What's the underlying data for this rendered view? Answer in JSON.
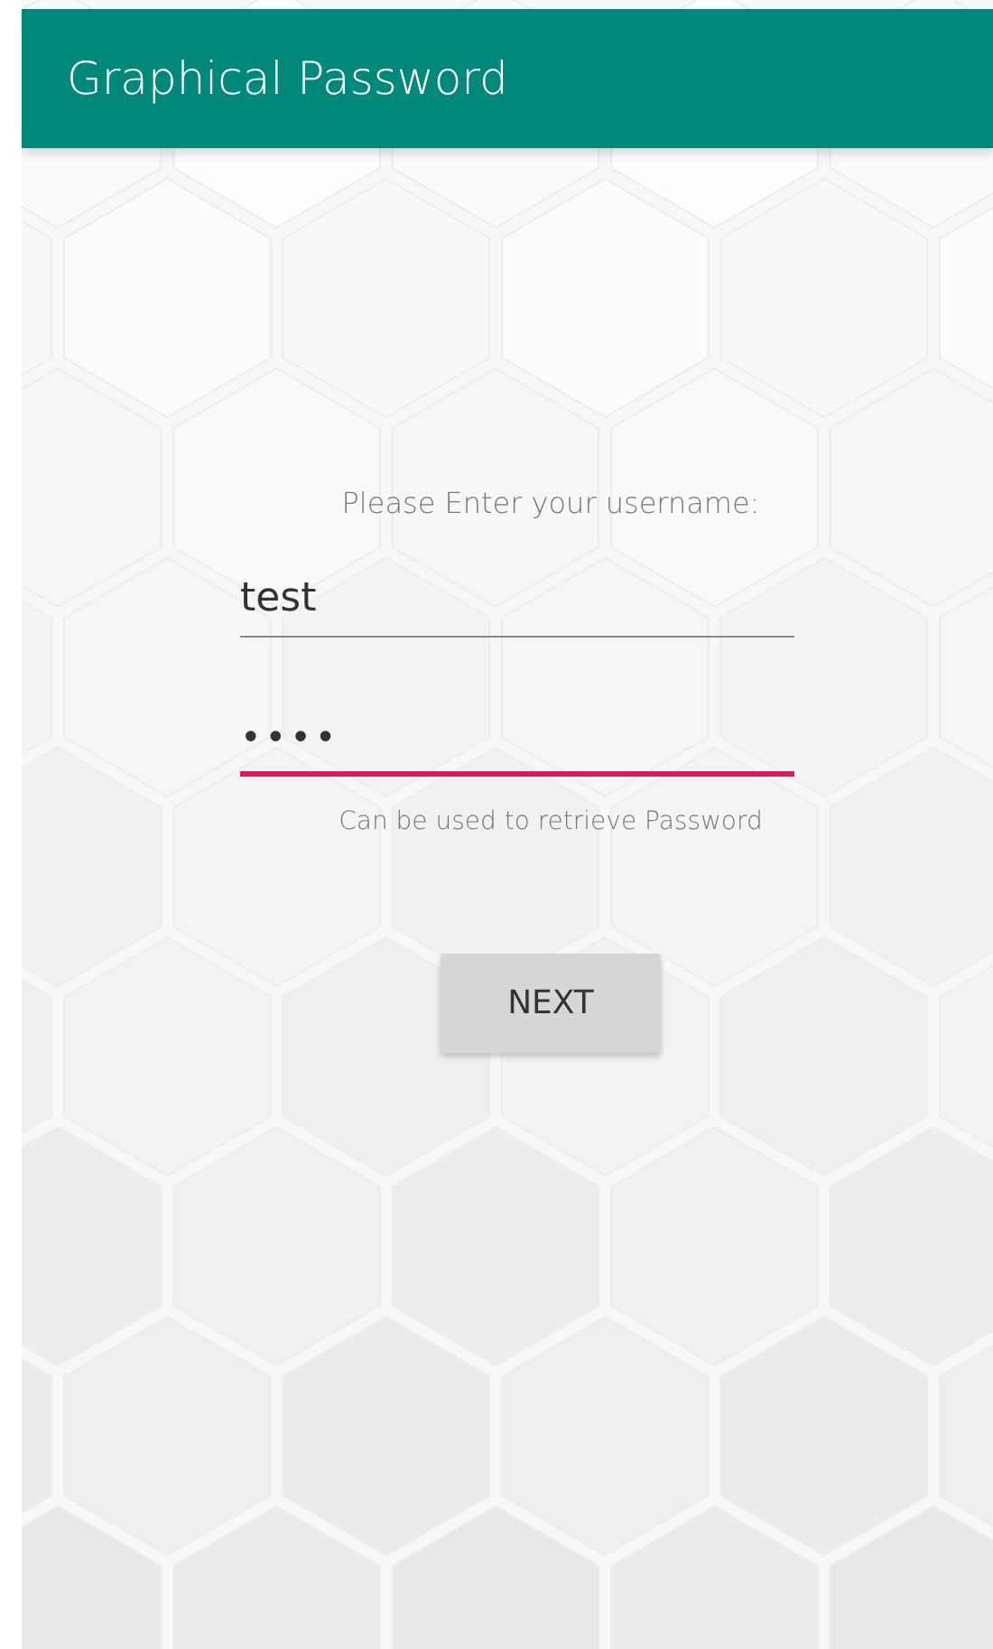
{
  "app_bar": {
    "title": "Graphical Password"
  },
  "form": {
    "prompt": "Please Enter your username:",
    "fields": [
      {
        "kind": "text",
        "value": "test",
        "focused": false
      },
      {
        "kind": "password",
        "value": "••••",
        "focused": true
      }
    ],
    "helper": "Can be used to retrieve Password",
    "button": "NEXT"
  }
}
